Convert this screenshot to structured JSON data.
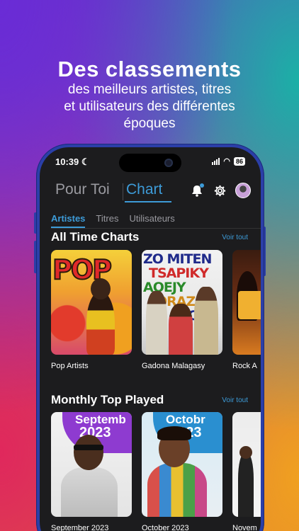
{
  "headline": {
    "title": "Des classements",
    "subtitle_line1": "des meilleurs artistes, titres",
    "subtitle_line2": "et utilisateurs des différentes",
    "subtitle_line3": "époques"
  },
  "status_bar": {
    "time": "10:39",
    "battery": "86"
  },
  "top_nav": {
    "tab_for_you": "Pour Toi",
    "tab_chart": "Chart"
  },
  "sub_tabs": [
    "Artistes",
    "Titres",
    "Utilisateurs"
  ],
  "sections": [
    {
      "title": "All Time Charts",
      "see_all": "Voir tout",
      "cards": [
        {
          "label": "Pop Artists",
          "art_text": "POP"
        },
        {
          "label": "Gadona Malagasy",
          "art_text": [
            "ZO MITEN",
            "TSAPIKY",
            "AOEJY",
            "ORAZAN",
            "ECC"
          ]
        },
        {
          "label": "Rock A"
        }
      ]
    },
    {
      "title": "Monthly Top Played",
      "see_all": "Voir tout",
      "cards": [
        {
          "label": "September 2023",
          "month": "Septemb",
          "year": "2023",
          "badge_color": "#8e3bd0"
        },
        {
          "label": "October 2023",
          "month": "Octobr",
          "year": "2023",
          "badge_color": "#2a8fd0"
        },
        {
          "label": "Novem"
        }
      ]
    }
  ],
  "colors": {
    "accent": "#3d9bd8",
    "phone_frame": "#2b3fa8",
    "screen_bg": "#1c1c1e"
  }
}
